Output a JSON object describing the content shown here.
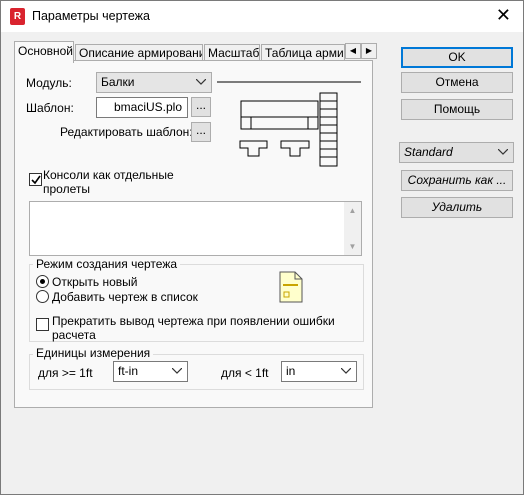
{
  "window": {
    "title": "Параметры чертежа",
    "app_icon_letter": "R",
    "close_glyph": "✕"
  },
  "tabs": [
    {
      "label": "Основной",
      "active": true
    },
    {
      "label": "Описание армирования",
      "active": false
    },
    {
      "label": "Масштаб",
      "active": false
    },
    {
      "label": "Таблица армир",
      "active": false
    }
  ],
  "tab_scroll": {
    "left": "◀",
    "right": "▶"
  },
  "main": {
    "module_label": "Модуль:",
    "module_value": "Балки",
    "template_label": "Шаблон:",
    "template_value": "bmaciUS.plo",
    "browse_label": "...",
    "edit_template_label": "Редактировать шаблон:",
    "edit_template_button": "...",
    "consoles_checkbox_label": "Консоли как отдельные\nпролеты",
    "consoles_checked": true,
    "description_text": ""
  },
  "mode_group": {
    "title": "Режим создания чертежа",
    "option_new": "Открыть новый",
    "option_add": "Добавить чертеж в список",
    "selected": "new",
    "stop_checkbox_label": "Прекратить вывод чертежа при появлении ошибки\nрасчета",
    "stop_checked": false
  },
  "units_group": {
    "title": "Единицы измерения",
    "ge_label": "для >= 1ft",
    "ge_value": "ft-in",
    "lt_label": "для < 1ft",
    "lt_value": "in"
  },
  "side_buttons": {
    "ok": "OK",
    "cancel": "Отмена",
    "help": "Помощь",
    "preset_value": "Standard",
    "save_as": "Сохранить как ...",
    "delete": "Удалить"
  },
  "colors": {
    "accent": "#0078d7",
    "app_icon": "#d9232e",
    "drawing_icon_fill": "#ffffcc"
  }
}
